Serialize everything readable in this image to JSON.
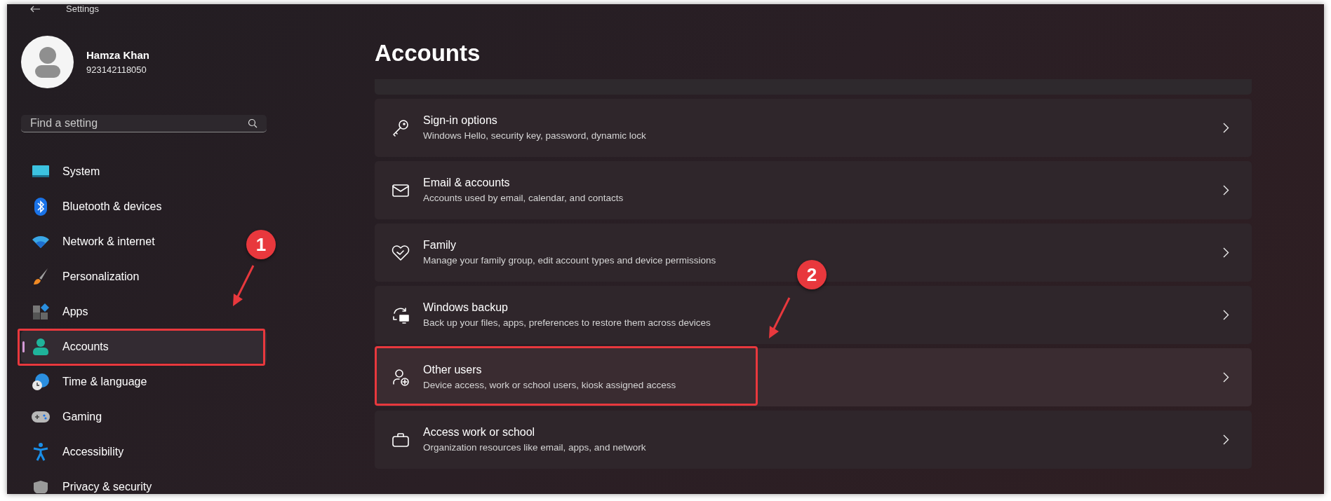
{
  "window": {
    "title": "Settings"
  },
  "user": {
    "name": "Hamza Khan",
    "account": "923142118050"
  },
  "search": {
    "placeholder": "Find a setting"
  },
  "nav": [
    {
      "label": "System",
      "selected": false
    },
    {
      "label": "Bluetooth & devices",
      "selected": false
    },
    {
      "label": "Network & internet",
      "selected": false
    },
    {
      "label": "Personalization",
      "selected": false
    },
    {
      "label": "Apps",
      "selected": false
    },
    {
      "label": "Accounts",
      "selected": true,
      "annotation": {
        "badge": "1"
      }
    },
    {
      "label": "Time & language",
      "selected": false
    },
    {
      "label": "Gaming",
      "selected": false
    },
    {
      "label": "Accessibility",
      "selected": false
    },
    {
      "label": "Privacy & security",
      "selected": false
    }
  ],
  "page": {
    "title": "Accounts"
  },
  "cards": [
    {
      "title": "Sign-in options",
      "description": "Windows Hello, security key, password, dynamic lock"
    },
    {
      "title": "Email & accounts",
      "description": "Accounts used by email, calendar, and contacts"
    },
    {
      "title": "Family",
      "description": "Manage your family group, edit account types and device permissions"
    },
    {
      "title": "Windows backup",
      "description": "Back up your files, apps, preferences to restore them across devices"
    },
    {
      "title": "Other users",
      "description": "Device access, work or school users, kiosk assigned access",
      "annotation": {
        "badge": "2"
      }
    },
    {
      "title": "Access work or school",
      "description": "Organization resources like email, apps, and network"
    }
  ]
}
